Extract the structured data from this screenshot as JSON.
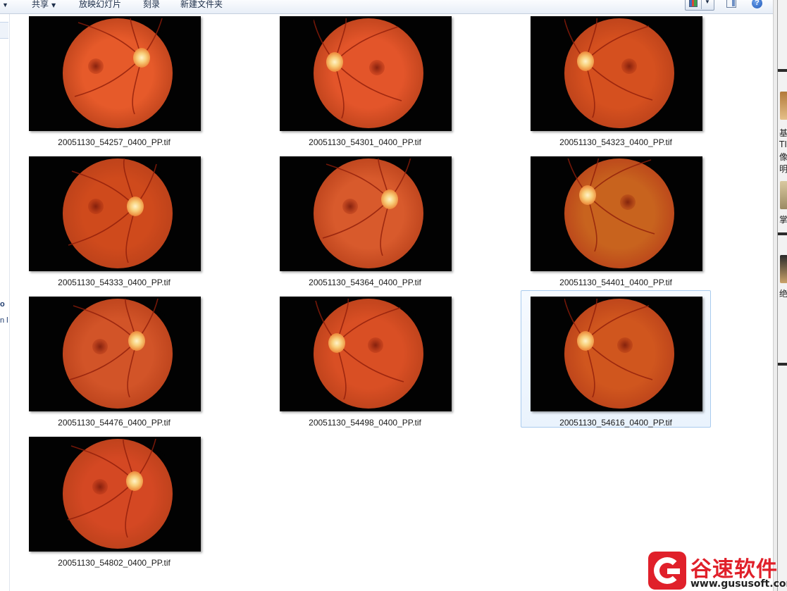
{
  "toolbar": {
    "items": [
      {
        "label": "共享",
        "has_dropdown": true
      },
      {
        "label": "放映幻灯片",
        "has_dropdown": false
      },
      {
        "label": "刻录",
        "has_dropdown": false
      },
      {
        "label": "新建文件夹",
        "has_dropdown": false
      }
    ],
    "help_symbol": "?"
  },
  "nav": {
    "fragments": [
      "o",
      "n l"
    ]
  },
  "right_strip": {
    "fragments": [
      "基",
      "TI",
      "像",
      "明",
      "掌",
      "绝"
    ]
  },
  "files": [
    {
      "name": "20051130_54257_0400_PP.tif",
      "selected": false
    },
    {
      "name": "20051130_54301_0400_PP.tif",
      "selected": false
    },
    {
      "name": "20051130_54323_0400_PP.tif",
      "selected": false
    },
    {
      "name": "20051130_54333_0400_PP.tif",
      "selected": false
    },
    {
      "name": "20051130_54364_0400_PP.tif",
      "selected": false
    },
    {
      "name": "20051130_54401_0400_PP.tif",
      "selected": false
    },
    {
      "name": "20051130_54476_0400_PP.tif",
      "selected": false
    },
    {
      "name": "20051130_54498_0400_PP.tif",
      "selected": false
    },
    {
      "name": "20051130_54616_0400_PP.tif",
      "selected": true
    },
    {
      "name": "20051130_54802_0400_PP.tif",
      "selected": false
    }
  ],
  "watermark": {
    "title": "谷速软件",
    "url": "www.gususoft.com"
  },
  "colors": {
    "selection_border": "#a9cbee",
    "selection_fill": "#eaf3fd",
    "watermark_red": "#e0202a"
  }
}
